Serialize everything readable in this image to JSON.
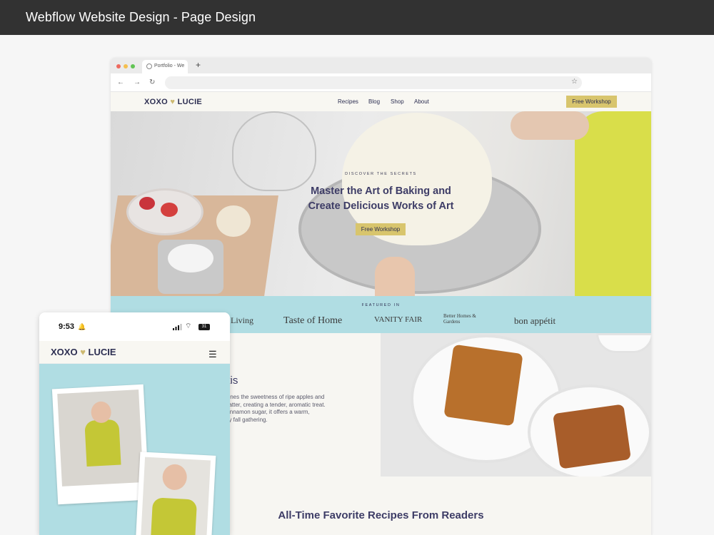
{
  "page": {
    "title": "Webflow Website Design - Page Design"
  },
  "browser": {
    "tab_label": "Portfolio - We",
    "new_tab": "+",
    "nav": {
      "back": "←",
      "forward": "→",
      "reload": "↻",
      "bookmark": "☆"
    },
    "traffic_lights": [
      "#ee6a5f",
      "#f5bf4f",
      "#61c454"
    ]
  },
  "site": {
    "logo": {
      "left": "XOXO",
      "heart": "♥",
      "right": "LUCIE"
    },
    "menu": [
      "Recipes",
      "Blog",
      "Shop",
      "About"
    ],
    "cta": "Free Workshop",
    "hero": {
      "kicker": "DISCOVER THE SECRETS",
      "headline_line1": "Master the Art of Baking and",
      "headline_line2": "Create Delicious Works of Art",
      "button": "Free Workshop"
    },
    "featured": {
      "label": "FEATURED IN",
      "brands": [
        "Living",
        "Taste of Home",
        "VANITY FAIR",
        "Better Homes & Gardens",
        "bon appétit"
      ]
    },
    "recipe": {
      "title_fragment": "utis",
      "description_lines": [
        "bines the sweetness of ripe apples and",
        "batter, creating a tender, aromatic treat.",
        "cinnamon sugar, it offers a warm,",
        "ny fall gathering."
      ]
    },
    "section_heading": "All-Time Favorite Recipes From Readers"
  },
  "phone": {
    "time": "9:53",
    "bell": "🔔",
    "wifi": "⌔",
    "battery": "31",
    "logo": {
      "left": "XOXO",
      "heart": "♥",
      "right": "LUCIE"
    },
    "menu_icon": "☰"
  },
  "colors": {
    "navy": "#2d2f52",
    "gold": "#d8c56d",
    "aqua": "#b0dde3",
    "cream": "#f7f6f2"
  }
}
